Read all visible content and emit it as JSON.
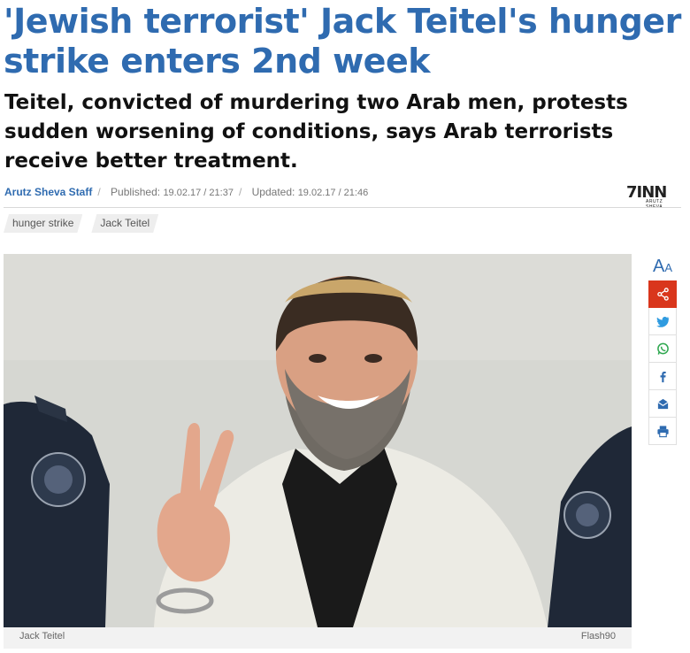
{
  "article": {
    "title": "'Jewish terrorist' Jack Teitel's hunger strike enters 2nd week",
    "subtitle": "Teitel, convicted of murdering two Arab men, protests sudden worsening of conditions, says Arab terrorists receive better treatment.",
    "author": "Arutz Sheva Staff",
    "published_label": "Published:",
    "published_value": "19.02.17 / 21:37",
    "updated_label": "Updated:",
    "updated_value": "19.02.17 / 21:46"
  },
  "logo": {
    "mark": "7INN",
    "subtitle": "ARUTZ SHEVA"
  },
  "tags": [
    "hunger strike",
    "Jack Teitel"
  ],
  "image": {
    "caption": "Jack Teitel",
    "credit": "Flash90"
  },
  "share": {
    "font_large": "A",
    "font_small": "A",
    "icons": [
      "share-icon",
      "twitter-icon",
      "whatsapp-icon",
      "facebook-icon",
      "email-icon",
      "print-icon"
    ]
  },
  "colors": {
    "headline": "#2f6bb0",
    "share_accent": "#d9361c",
    "whatsapp": "#2fa850"
  }
}
